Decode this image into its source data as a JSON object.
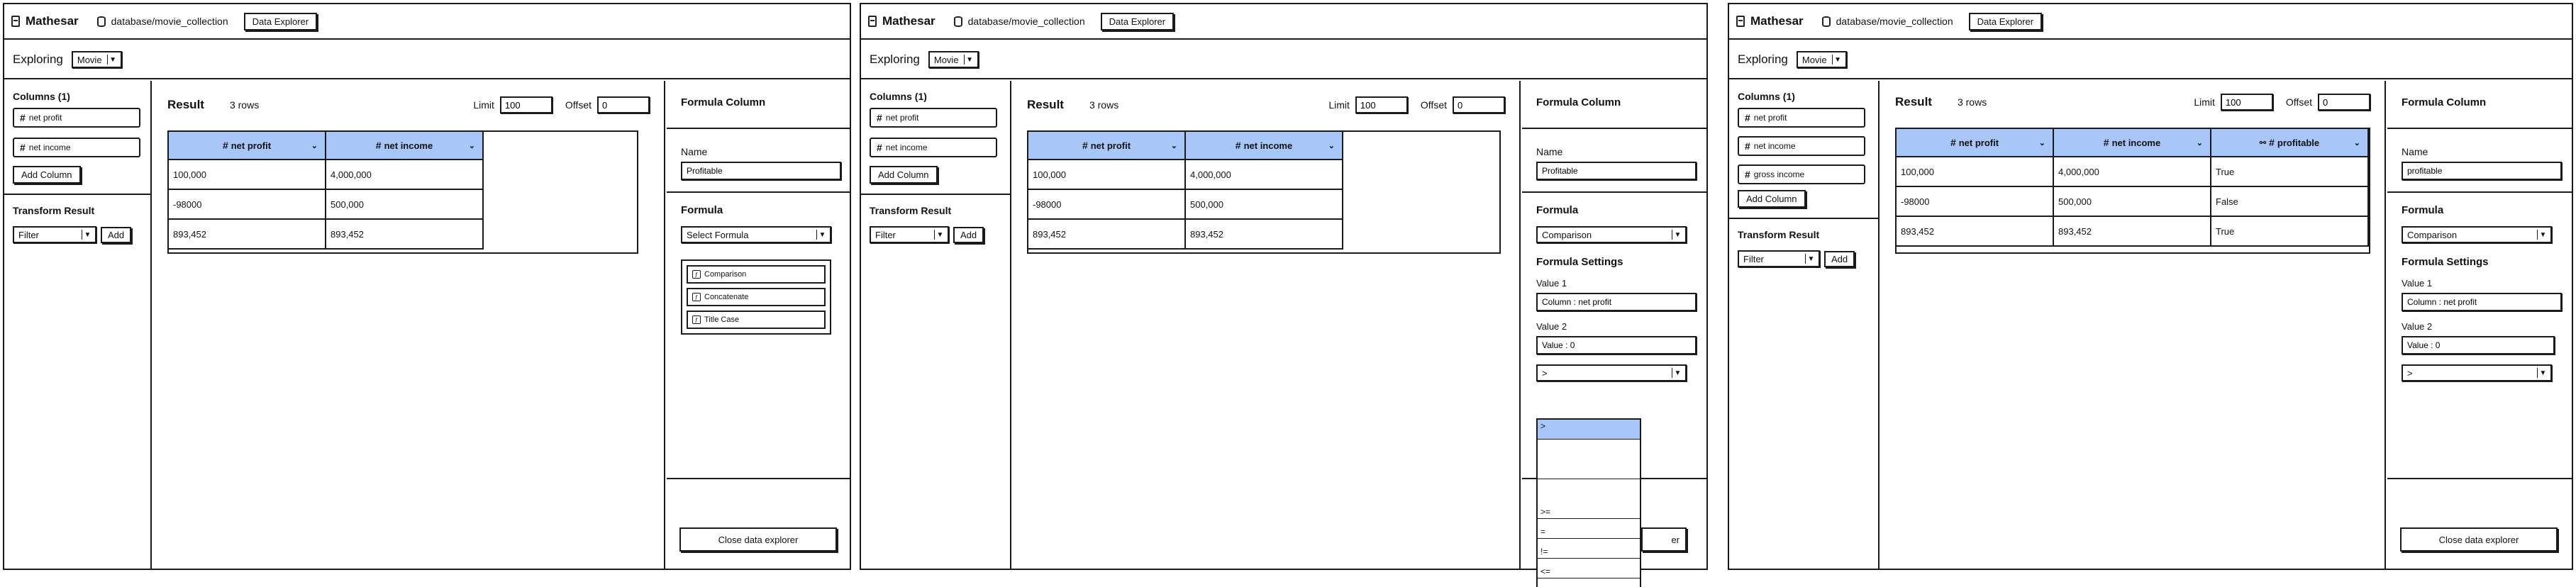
{
  "app_name": "Mathesar",
  "breadcrumb": "database/movie_collection",
  "data_explorer_button": "Data Explorer",
  "exploring_label": "Exploring",
  "table_selected": "Movie",
  "columns_section_title": "Columns (1)",
  "add_column_button": "Add Column",
  "transform_title": "Transform Result",
  "transform_select": "Filter",
  "transform_add_button": "Add",
  "result_title": "Result",
  "rows_count": "3 rows",
  "limit_label": "Limit",
  "limit_value": "100",
  "offset_label": "Offset",
  "offset_value": "0",
  "formula_column_title": "Formula Column",
  "name_label": "Name",
  "formula_label": "Formula",
  "formula_settings_label": "Formula Settings",
  "value1_label": "Value 1",
  "value2_label": "Value 2",
  "close_button": "Close data explorer",
  "header_color": "#a8c6f7",
  "rows": [
    {
      "net_profit": "100,000",
      "net_income": "4,000,000",
      "profitable": "True"
    },
    {
      "net_profit": "-98000",
      "net_income": "500,000",
      "profitable": "False"
    },
    {
      "net_profit": "893,452",
      "net_income": "893,452",
      "profitable": "True"
    }
  ],
  "col_headers": {
    "net_profit": "net profit",
    "net_income": "net income",
    "profitable": "profitable"
  },
  "panel1": {
    "columns": [
      "net profit",
      "net income"
    ],
    "name_value": "Profitable",
    "formula_select": "Select Formula",
    "formula_options": [
      "Comparison",
      "Concatenate",
      "Title Case"
    ]
  },
  "panel2": {
    "columns": [
      "net profit",
      "net income"
    ],
    "name_value": "Profitable",
    "formula_select": "Comparison",
    "value1": "Column : net profit",
    "value2": "Value : 0",
    "operator": ">",
    "operator_options": [
      ">",
      ">=",
      "=",
      "!=",
      "<=",
      "<"
    ],
    "close_partial": "er"
  },
  "panel3": {
    "columns": [
      "net profit",
      "net income",
      "gross income"
    ],
    "name_value": "profitable",
    "formula_select": "Comparison",
    "value1": "Column : net profit",
    "value2": "Value : 0",
    "operator": ">"
  }
}
